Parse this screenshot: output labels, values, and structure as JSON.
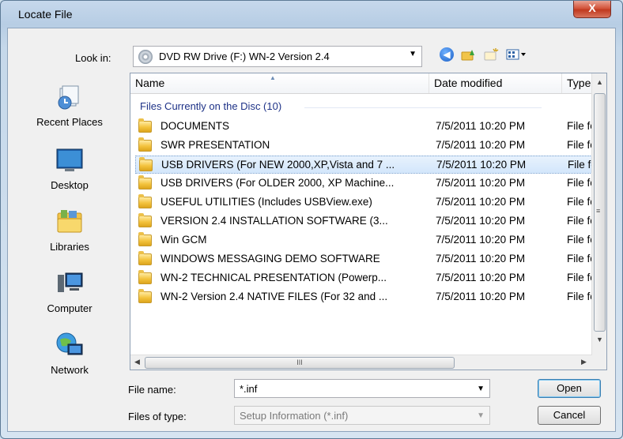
{
  "window": {
    "title": "Locate File",
    "close_glyph": "X"
  },
  "lookin": {
    "label": "Look in:",
    "value": "DVD RW Drive (F:) WN-2 Version 2.4",
    "icon": "dvd-drive-icon"
  },
  "toolbar": {
    "icons": [
      "back-icon",
      "up-folder-icon",
      "new-folder-icon",
      "view-menu-icon"
    ]
  },
  "places": [
    {
      "label": "Recent Places",
      "icon": "recent-places-icon"
    },
    {
      "label": "Desktop",
      "icon": "desktop-icon"
    },
    {
      "label": "Libraries",
      "icon": "libraries-icon"
    },
    {
      "label": "Computer",
      "icon": "computer-icon"
    },
    {
      "label": "Network",
      "icon": "network-icon"
    }
  ],
  "columns": [
    "Name",
    "Date modified",
    "Type"
  ],
  "group_label": "Files Currently on the Disc (10)",
  "files": [
    {
      "name": "DOCUMENTS",
      "date": "7/5/2011 10:20 PM",
      "type": "File fol"
    },
    {
      "name": "SWR PRESENTATION",
      "date": "7/5/2011 10:20 PM",
      "type": "File fol"
    },
    {
      "name": "USB DRIVERS (For NEW 2000,XP,Vista and 7 ...",
      "date": "7/5/2011 10:20 PM",
      "type": "File fol"
    },
    {
      "name": "USB DRIVERS (For OLDER 2000, XP  Machine...",
      "date": "7/5/2011 10:20 PM",
      "type": "File fol"
    },
    {
      "name": "USEFUL UTILITIES (Includes USBView.exe)",
      "date": "7/5/2011 10:20 PM",
      "type": "File fol"
    },
    {
      "name": "VERSION 2.4  INSTALLATION SOFTWARE (3...",
      "date": "7/5/2011 10:20 PM",
      "type": "File fol"
    },
    {
      "name": "Win GCM",
      "date": "7/5/2011 10:20 PM",
      "type": "File fol"
    },
    {
      "name": "WINDOWS MESSAGING DEMO SOFTWARE",
      "date": "7/5/2011 10:20 PM",
      "type": "File fol"
    },
    {
      "name": "WN-2 TECHNICAL PRESENTATION (Powerp...",
      "date": "7/5/2011 10:20 PM",
      "type": "File fol"
    },
    {
      "name": "WN-2 Version 2.4  NATIVE FILES (For 32 and ...",
      "date": "7/5/2011 10:20 PM",
      "type": "File fol"
    }
  ],
  "selected_index": 2,
  "filename": {
    "label": "File name:",
    "value": "*.inf"
  },
  "filetype": {
    "label": "Files of type:",
    "value": "Setup Information (*.inf)"
  },
  "buttons": {
    "open": "Open",
    "cancel": "Cancel"
  },
  "hscroll_grip": "III"
}
